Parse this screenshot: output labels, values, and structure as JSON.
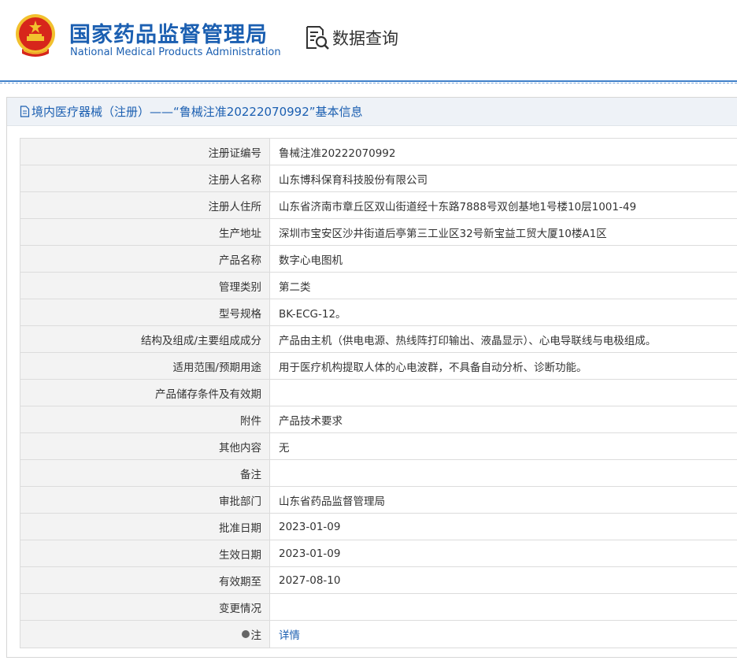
{
  "header": {
    "org_cn": "国家药品监督管理局",
    "org_en": "National Medical Products Administration",
    "data_query_label": "数据查询",
    "emblem_icon": "national-emblem-icon",
    "data_query_icon": "document-search-icon",
    "colors": {
      "brand": "#1b5fb1",
      "emblem_red": "#d7261b",
      "emblem_gold": "#f2c12e"
    }
  },
  "panel": {
    "title": "境内医疗器械（注册）——“鲁械注准20222070992”基本信息",
    "title_icon": "document-icon"
  },
  "rows": [
    {
      "label": "注册证编号",
      "value": "鲁械注准20222070992"
    },
    {
      "label": "注册人名称",
      "value": "山东博科保育科技股份有限公司"
    },
    {
      "label": "注册人住所",
      "value": "山东省济南市章丘区双山街道经十东路7888号双创基地1号楼10层1001-49"
    },
    {
      "label": "生产地址",
      "value": "深圳市宝安区沙井街道后亭第三工业区32号新宝益工贸大厦10楼A1区"
    },
    {
      "label": "产品名称",
      "value": "数字心电图机"
    },
    {
      "label": "管理类别",
      "value": "第二类"
    },
    {
      "label": "型号规格",
      "value": "BK-ECG-12。"
    },
    {
      "label": "结构及组成/主要组成成分",
      "value": "产品由主机（供电电源、热线阵打印输出、液晶显示）、心电导联线与电极组成。"
    },
    {
      "label": "适用范围/预期用途",
      "value": "用于医疗机构提取人体的心电波群，不具备自动分析、诊断功能。"
    },
    {
      "label": "产品储存条件及有效期",
      "value": ""
    },
    {
      "label": "附件",
      "value": "产品技术要求"
    },
    {
      "label": "其他内容",
      "value": "无"
    },
    {
      "label": "备注",
      "value": ""
    },
    {
      "label": "审批部门",
      "value": "山东省药品监督管理局"
    },
    {
      "label": "批准日期",
      "value": "2023-01-09"
    },
    {
      "label": "生效日期",
      "value": "2023-01-09"
    },
    {
      "label": "有效期至",
      "value": "2027-08-10"
    },
    {
      "label": "变更情况",
      "value": ""
    }
  ],
  "note_row": {
    "label": "注",
    "link": "详情",
    "icon": "note-dot-icon"
  }
}
